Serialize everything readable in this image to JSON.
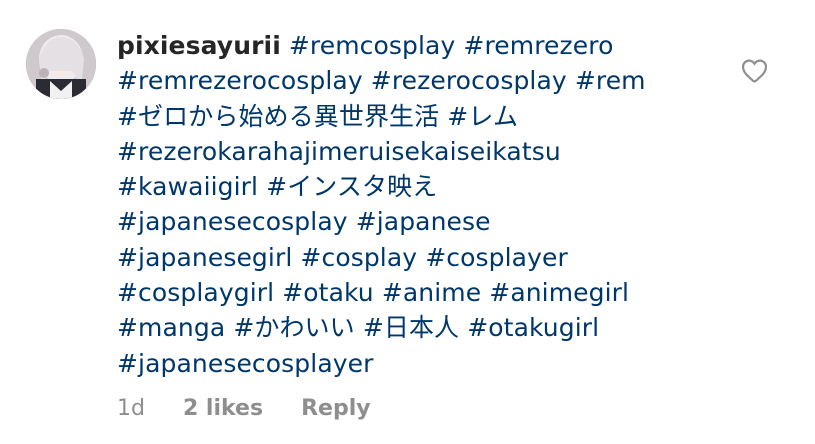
{
  "comment": {
    "username": "pixiesayurii",
    "hashtag_lines": [
      [
        "#remcosplay",
        "#remrezero"
      ],
      [
        "#remrezerocosplay",
        "#rezerocosplay",
        "#rem"
      ],
      [
        "#ゼロから始める異世界生活",
        "#レム"
      ],
      [
        "#rezerokarahajimeruisekaiseikatsu"
      ],
      [
        "#kawaiigirl",
        "#インスタ映え"
      ],
      [
        "#japanesecosplay",
        "#japanese"
      ],
      [
        "#japanesegirl",
        "#cosplay",
        "#cosplayer"
      ],
      [
        "#cosplaygirl",
        "#otaku",
        "#anime",
        "#animegirl"
      ],
      [
        "#manga",
        "#かわいい",
        "#日本人",
        "#otakugirl"
      ],
      [
        "#japanesecosplayer"
      ]
    ],
    "time": "1d",
    "likes": "2 likes",
    "reply_label": "Reply",
    "like_icon": "heart-outline-icon",
    "avatar_icon": "user-avatar"
  },
  "colors": {
    "text": "#262626",
    "hashtag": "#00376b",
    "meta": "#8e8e8e",
    "icon": "#8e8e8e"
  }
}
